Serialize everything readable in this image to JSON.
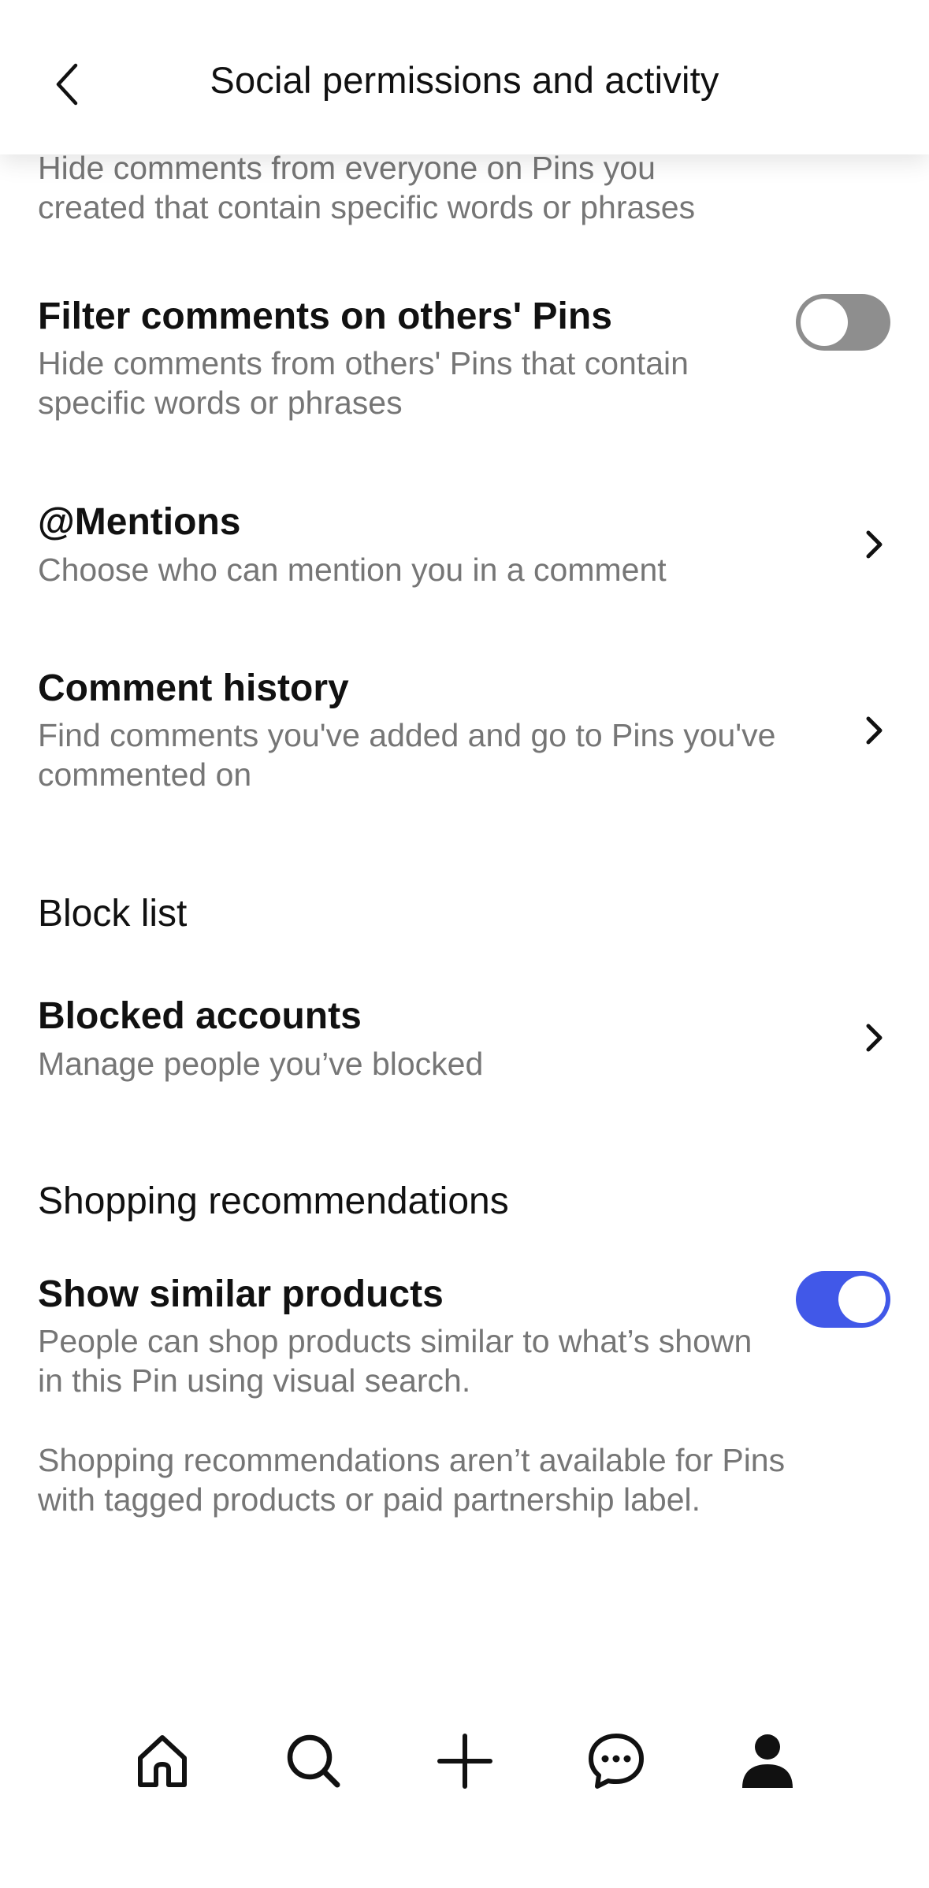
{
  "header": {
    "title": "Social permissions and activity",
    "back_icon": "chevron-left-icon"
  },
  "comments": {
    "filter_own_desc_partial": "Hide comments from everyone on Pins you created that contain specific words or phrases",
    "filter_others": {
      "title": "Filter comments on others' Pins",
      "description": "Hide comments from others' Pins that contain specific words or phrases",
      "enabled": false
    },
    "mentions": {
      "title": "@Mentions",
      "description": "Choose who can mention you in a comment"
    },
    "history": {
      "title": "Comment history",
      "description": "Find comments you've added and go to Pins you've commented on"
    }
  },
  "block_list": {
    "section_title": "Block list",
    "blocked_accounts": {
      "title": "Blocked accounts",
      "description": "Manage people you’ve blocked"
    }
  },
  "shopping": {
    "section_title": "Shopping recommendations",
    "similar_products": {
      "title": "Show similar products",
      "description": "People can shop products similar to what’s shown in this Pin using visual search.",
      "enabled": true
    },
    "note": "Shopping recommendations aren’t available for Pins with tagged products or paid partnership label."
  },
  "tab_bar": {
    "items": [
      {
        "icon": "home-icon"
      },
      {
        "icon": "search-icon"
      },
      {
        "icon": "plus-icon"
      },
      {
        "icon": "messages-icon"
      },
      {
        "icon": "profile-icon"
      }
    ]
  },
  "colors": {
    "toggle_on": "#4158e8",
    "toggle_off": "#8e8e8e",
    "secondary_text": "#767676",
    "primary_text": "#111111"
  }
}
